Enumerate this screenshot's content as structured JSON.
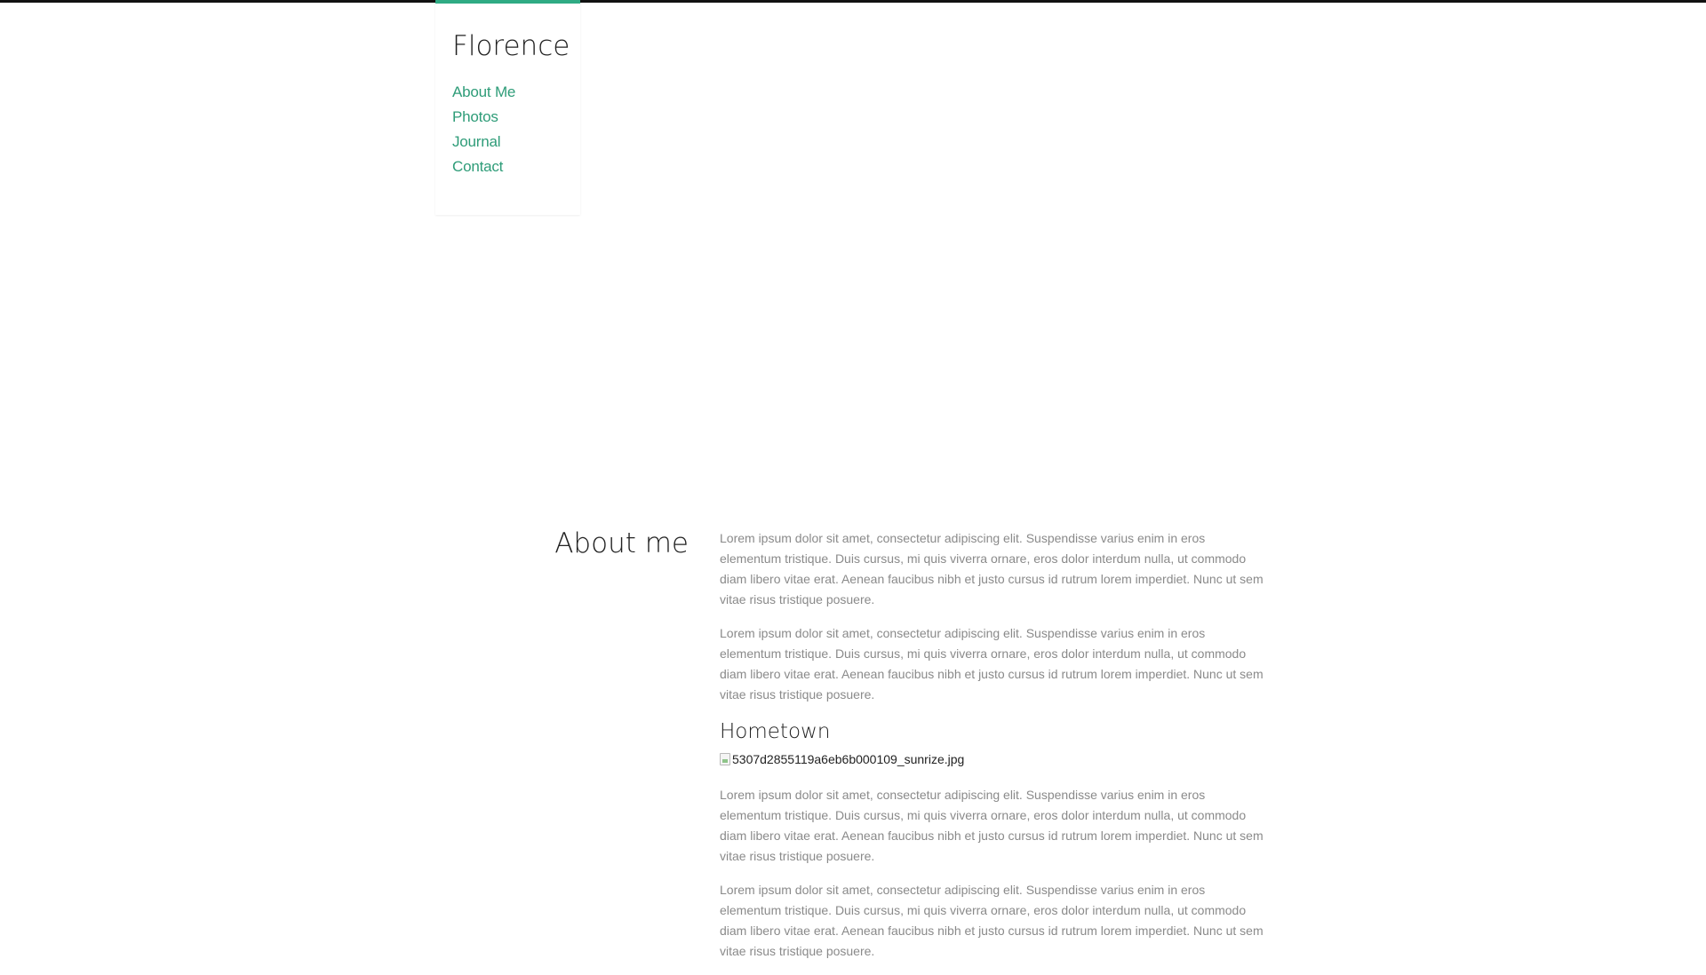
{
  "site": {
    "title": "Florence",
    "accent_color": "#2fab84"
  },
  "nav": {
    "items": [
      {
        "label": "About Me"
      },
      {
        "label": "Photos"
      },
      {
        "label": "Journal"
      },
      {
        "label": "Contact"
      }
    ]
  },
  "about": {
    "heading": "About me",
    "paragraphs": [
      "Lorem ipsum dolor sit amet, consectetur adipiscing elit. Suspendisse varius enim in eros elementum tristique. Duis cursus, mi quis viverra ornare, eros dolor interdum nulla, ut commodo diam libero vitae erat. Aenean faucibus nibh et justo cursus id rutrum lorem imperdiet. Nunc ut sem vitae risus tristique posuere.",
      "Lorem ipsum dolor sit amet, consectetur adipiscing elit. Suspendisse varius enim in eros elementum tristique. Duis cursus, mi quis viverra ornare, eros dolor interdum nulla, ut commodo diam libero vitae erat. Aenean faucibus nibh et justo cursus id rutrum lorem imperdiet. Nunc ut sem vitae risus tristique posuere."
    ]
  },
  "hometown": {
    "heading": "Hometown",
    "image_alt": "5307d2855119a6eb6b000109_sunrize.jpg",
    "image_icon": "broken-image-icon",
    "paragraphs": [
      "Lorem ipsum dolor sit amet, consectetur adipiscing elit. Suspendisse varius enim in eros elementum tristique. Duis cursus, mi quis viverra ornare, eros dolor interdum nulla, ut commodo diam libero vitae erat. Aenean faucibus nibh et justo cursus id rutrum lorem imperdiet. Nunc ut sem vitae risus tristique posuere.",
      "Lorem ipsum dolor sit amet, consectetur adipiscing elit. Suspendisse varius enim in eros elementum tristique. Duis cursus, mi quis viverra ornare, eros dolor interdum nulla, ut commodo diam libero vitae erat. Aenean faucibus nibh et justo cursus id rutrum lorem imperdiet. Nunc ut sem vitae risus tristique posuere."
    ]
  }
}
